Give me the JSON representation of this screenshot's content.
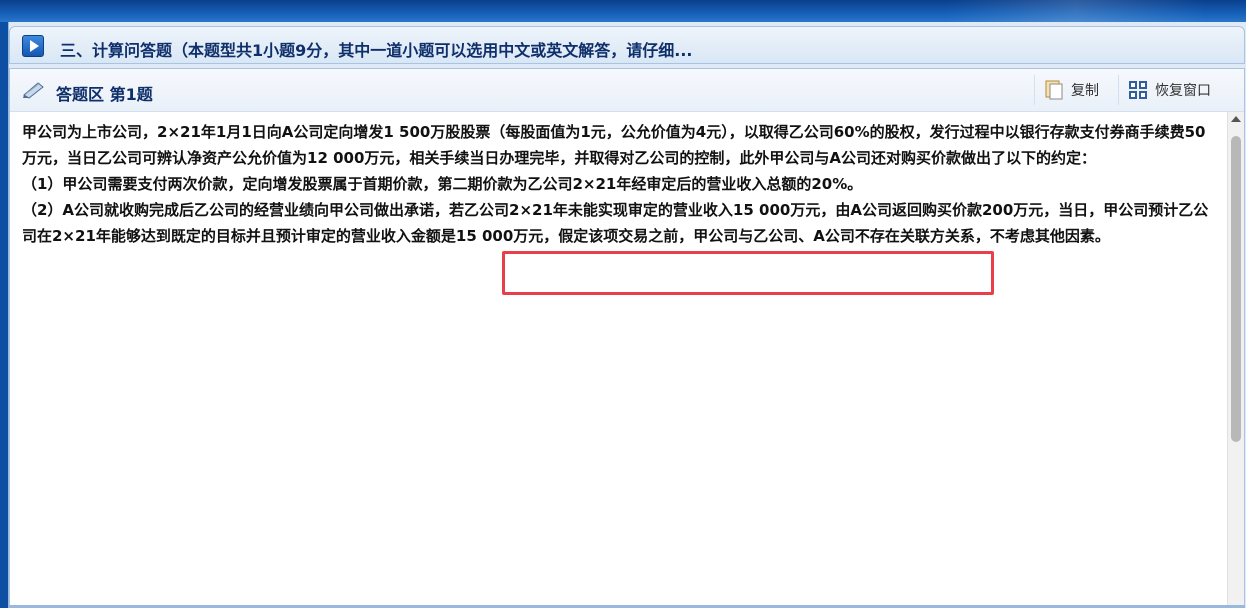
{
  "section_header": {
    "title": "三、计算问答题（本题型共1小题9分，其中一道小题可以选用中文或英文解答，请仔细..."
  },
  "answer_area": {
    "title": "答题区 第1题",
    "copy_label": "复制",
    "restore_label": "恢复窗口"
  },
  "question": {
    "paragraph1": "甲公司为上市公司，2×21年1月1日向A公司定向增发1 500万股股票（每股面值为1元，公允价值为4元），以取得乙公司60%的股权，发行过程中以银行存款支付券商手续费50万元，当日乙公司可辨认净资产公允价值为12 000万元，相关手续当日办理完毕，并取得对乙公司的控制，此外甲公司与A公司还对购买价款做出了以下的约定：",
    "item1": "（1）甲公司需要支付两次价款，定向增发股票属于首期价款，第二期价款为乙公司2×21年经审定后的营业收入总额的20%。",
    "item2": "（2）A公司就收购完成后乙公司的经营业绩向甲公司做出承诺，若乙公司2×21年未能实现审定的营业收入15 000万元，由A公司返回购买价款200万元，当日，甲公司预计乙公司在2×21年能够达到既定的目标并且预计审定的营业收入金额是15 000万元，假定该项交易之前，甲公司与乙公司、A公司不存在关联方关系，不考虑其他因素。"
  },
  "icons": {
    "header": "play-icon",
    "answer": "pencil-icon",
    "copy": "copy-icon",
    "restore": "restore-window-icon"
  },
  "colors": {
    "highlight": "#e8404a",
    "title_text": "#0f2f6b"
  }
}
